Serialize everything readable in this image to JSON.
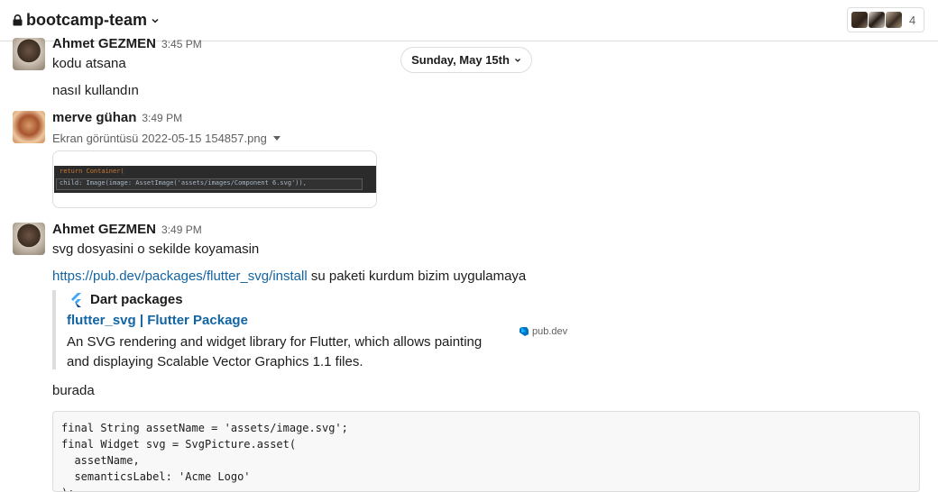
{
  "header": {
    "channel_name": "bootcamp-team",
    "member_count": "4",
    "icons": [
      "lock-icon",
      "chevron-down-icon"
    ]
  },
  "date_divider": {
    "label": "Sunday, May 15th"
  },
  "messages": [
    {
      "author": "Ahmet GEZMEN",
      "time": "3:45 PM",
      "lines": [
        "kodu atsana",
        "nasıl kullandın"
      ]
    },
    {
      "author": "merve gühan",
      "time": "3:49 PM",
      "file_name": "Ekran görüntüsü 2022-05-15 154857.png",
      "image_code": {
        "line1": "return Container(",
        "line2": "  child: Image(image: AssetImage('assets/images/Component 6.svg')),"
      }
    },
    {
      "author": "Ahmet GEZMEN",
      "time": "3:49 PM",
      "line1": "svg dosyasini o sekilde koyamasin",
      "link_url": "https://pub.dev/packages/flutter_svg/install",
      "link_suffix": " su paketi kurdum bizim uygulamaya",
      "unfurl": {
        "source": "Dart packages",
        "title": "flutter_svg | Flutter Package",
        "description": "An SVG rendering and widget library for Flutter, which allows painting and displaying Scalable Vector Graphics 1.1 files.",
        "thumb_domain": "pub.dev"
      },
      "after_text": "burada",
      "code": "final String assetName = 'assets/image.svg';\nfinal Widget svg = SvgPicture.asset(\n  assetName,\n  semanticsLabel: 'Acme Logo'\n);"
    }
  ],
  "colors": {
    "link": "#1264a3",
    "text": "#1d1c1d",
    "muted": "#616061",
    "border": "#dddddd"
  }
}
